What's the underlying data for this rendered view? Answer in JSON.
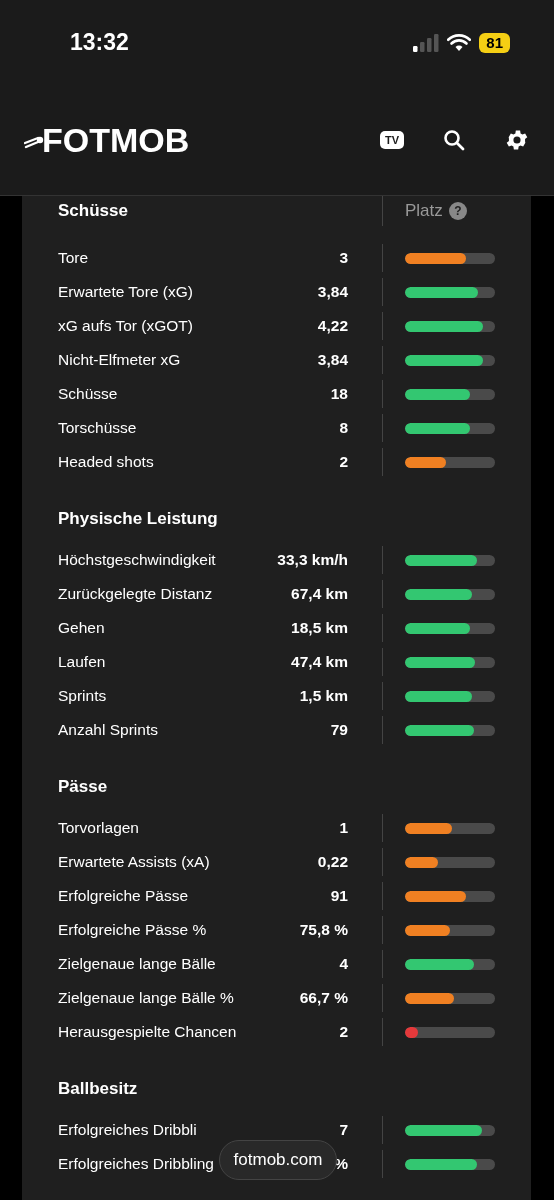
{
  "status_bar": {
    "time": "13:32",
    "battery": "81"
  },
  "header": {
    "logo": "FOTMOB",
    "tv_label": "TV"
  },
  "stats_header": {
    "title": "Schüsse",
    "rank_label": "Platz",
    "help": "?"
  },
  "sections": [
    {
      "rows": [
        {
          "label": "Tore",
          "value": "3",
          "level": 0.68,
          "color": "#f08022"
        },
        {
          "label": "Erwartete Tore (xG)",
          "value": "3,84",
          "level": 0.81,
          "color": "#33c771"
        },
        {
          "label": "xG aufs Tor (xGOT)",
          "value": "4,22",
          "level": 0.87,
          "color": "#33c771"
        },
        {
          "label": "Nicht-Elfmeter xG",
          "value": "3,84",
          "level": 0.87,
          "color": "#33c771"
        },
        {
          "label": "Schüsse",
          "value": "18",
          "level": 0.72,
          "color": "#33c771"
        },
        {
          "label": "Torschüsse",
          "value": "8",
          "level": 0.72,
          "color": "#33c771"
        },
        {
          "label": "Headed shots",
          "value": "2",
          "level": 0.45,
          "color": "#f08022"
        }
      ]
    },
    {
      "title": "Physische Leistung",
      "rows": [
        {
          "label": "Höchstgeschwindigkeit",
          "value": "33,3 km/h",
          "level": 0.8,
          "color": "#33c771"
        },
        {
          "label": "Zurückgelegte Distanz",
          "value": "67,4 km",
          "level": 0.74,
          "color": "#33c771"
        },
        {
          "label": "Gehen",
          "value": "18,5 km",
          "level": 0.72,
          "color": "#33c771"
        },
        {
          "label": "Laufen",
          "value": "47,4 km",
          "level": 0.78,
          "color": "#33c771"
        },
        {
          "label": "Sprints",
          "value": "1,5 km",
          "level": 0.74,
          "color": "#33c771"
        },
        {
          "label": "Anzahl Sprints",
          "value": "79",
          "level": 0.77,
          "color": "#33c771"
        }
      ]
    },
    {
      "title": "Pässe",
      "rows": [
        {
          "label": "Torvorlagen",
          "value": "1",
          "level": 0.52,
          "color": "#f08022"
        },
        {
          "label": "Erwartete Assists (xA)",
          "value": "0,22",
          "level": 0.37,
          "color": "#f08022"
        },
        {
          "label": "Erfolgreiche Pässe",
          "value": "91",
          "level": 0.68,
          "color": "#f08022"
        },
        {
          "label": "Erfolgreiche Pässe %",
          "value": "75,8 %",
          "level": 0.5,
          "color": "#f08022"
        },
        {
          "label": "Zielgenaue lange Bälle",
          "value": "4",
          "level": 0.77,
          "color": "#33c771"
        },
        {
          "label": "Zielgenaue lange Bälle %",
          "value": "66,7 %",
          "level": 0.54,
          "color": "#f08022"
        },
        {
          "label": "Herausgespielte Chancen",
          "value": "2",
          "level": 0.14,
          "color": "#e5393b"
        }
      ]
    },
    {
      "title": "Ballbesitz",
      "rows": [
        {
          "label": "Erfolgreiches Dribbli",
          "value": "7",
          "level": 0.85,
          "color": "#33c771"
        },
        {
          "label": "Erfolgreiches Dribbling",
          "value": "%",
          "level": 0.8,
          "color": "#33c771"
        }
      ]
    }
  ],
  "url_pill": "fotmob.com"
}
